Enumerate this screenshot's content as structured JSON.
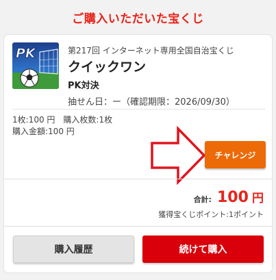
{
  "heading": "ご購入いただいた宝くじ",
  "item": {
    "thumbnail_text": "PK",
    "round": "第217回 インターネット専用全国自治宝くじ",
    "name": "クイックワン",
    "variant": "PK対決",
    "draw_date": "抽せん日：ー（確認期限：2026/09/30）",
    "detail_line1": "1枚:100 円　購入枚数:1枚",
    "detail_line2": "購入金額:100 円"
  },
  "actions": {
    "challenge_label": "チャレンジ",
    "history_label": "購入履歴",
    "continue_label": "続けて購入"
  },
  "total": {
    "label": "合計:",
    "value": "100",
    "unit": "円",
    "points": "獲得宝くじポイント:1ポイント"
  },
  "colors": {
    "accent_red": "#e8231a",
    "challenge_orange": "#ec6a08",
    "continue_red": "#d9000b",
    "arrow_red": "#e0141e"
  }
}
